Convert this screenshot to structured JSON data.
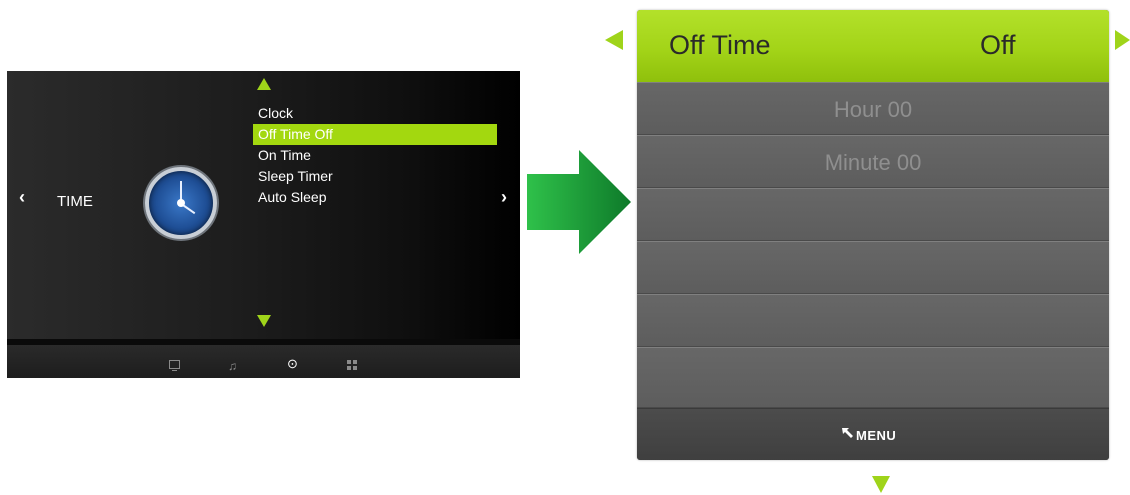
{
  "tv_menu": {
    "category": "TIME",
    "nav_left": "‹",
    "nav_right": "›",
    "items": [
      {
        "label": "Clock"
      },
      {
        "label": "Off Time Off"
      },
      {
        "label": "On Time"
      },
      {
        "label": "Sleep Timer"
      },
      {
        "label": "Auto Sleep"
      }
    ],
    "selected_index": 1,
    "footer_icons": [
      "monitor-icon",
      "music-note-icon",
      "clock-icon",
      "grid-icon"
    ],
    "active_footer_icon": "clock-icon",
    "accent_color": "#a3d80f"
  },
  "detail_panel": {
    "title": "Off Time",
    "value": "Off",
    "rows": [
      {
        "label": "Hour 00"
      },
      {
        "label": "Minute 00"
      },
      {
        "label": ""
      },
      {
        "label": ""
      },
      {
        "label": ""
      },
      {
        "label": ""
      }
    ],
    "footer_label": "MENU",
    "header_color": "#a3d418"
  }
}
